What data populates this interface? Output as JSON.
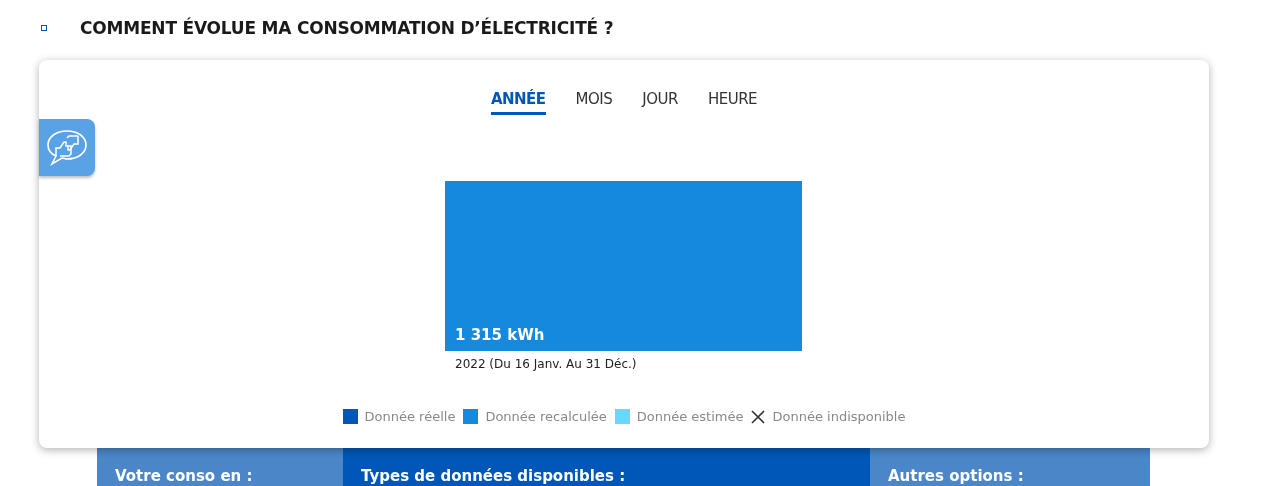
{
  "section_title": "COMMENT ÉVOLUE MA CONSOMMATION D’ÉLECTRICITÉ ?",
  "tabs": [
    {
      "label": "ANNÉE",
      "selected": true
    },
    {
      "label": "MOIS",
      "selected": false
    },
    {
      "label": "JOUR",
      "selected": false
    },
    {
      "label": "HEURE",
      "selected": false
    }
  ],
  "consumption_bar": {
    "value": "1 315 kWh",
    "period": "2022 (Du 16 Janv. Au 31 Déc.)"
  },
  "legend": [
    {
      "kind": "swatch",
      "label": "Donnée réelle",
      "color": "#0057b8"
    },
    {
      "kind": "swatch",
      "label": "Donnée recalculée",
      "color": "#1489dd"
    },
    {
      "kind": "swatch",
      "label": "Donnée estimée",
      "color": "#66d9ff"
    },
    {
      "kind": "cross",
      "label": "Donnée indisponible"
    }
  ],
  "panels": [
    {
      "title": "Votre conso en :",
      "color": "#4a86c8"
    },
    {
      "title": "Types de données disponibles :",
      "color": "#0057b8"
    },
    {
      "title": "Autres options :",
      "color": "#4a86c8"
    }
  ]
}
